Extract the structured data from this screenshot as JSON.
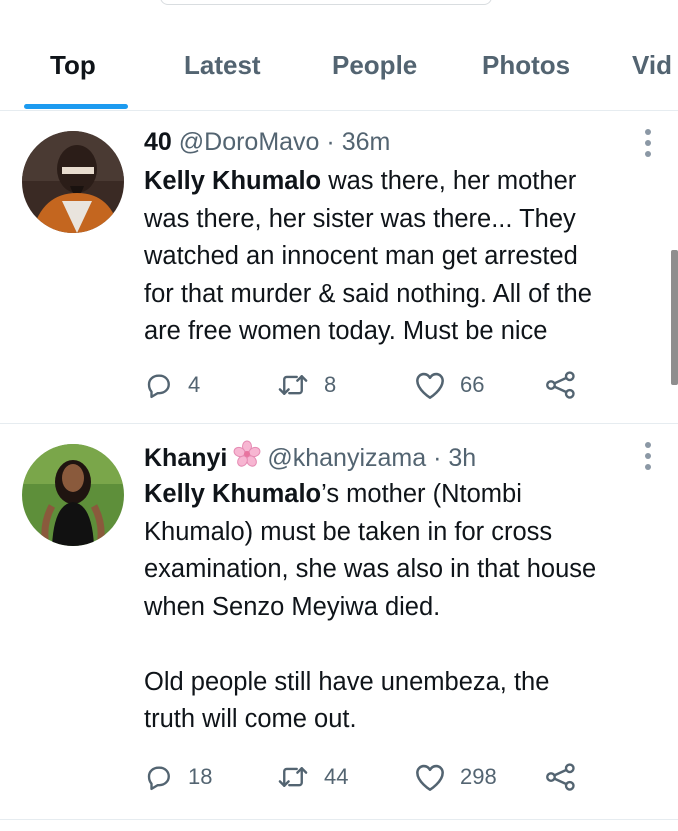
{
  "tabs": [
    {
      "label": "Top",
      "active": true
    },
    {
      "label": "Latest",
      "active": false
    },
    {
      "label": "People",
      "active": false
    },
    {
      "label": "Photos",
      "active": false
    },
    {
      "label": "Vid",
      "active": false
    }
  ],
  "accent_color": "#1d9bf0",
  "tweets": [
    {
      "name": "40",
      "handle": "@DoroMavo",
      "time": "· 36m",
      "mention": "Kelly Khumalo",
      "line1_rest": " was there, her mother",
      "lines": [
        "was there, her sister was there... They",
        "watched an innocent man get arrested",
        "for that murder & said nothing. All of the",
        "are free women today. Must be nice"
      ],
      "replies": "4",
      "retweets": "8",
      "likes": "66"
    },
    {
      "name": "Khanyi",
      "name_icon": "cherry-blossom-icon",
      "handle": "@khanyizama",
      "time": "· 3h",
      "mention": "Kelly Khumalo",
      "line1_rest": "’s mother (Ntombi",
      "lines": [
        "Khumalo) must be taken in for cross",
        "examination, she was also in that house",
        "when Senzo Meyiwa died."
      ],
      "para2": [
        "Old people still have unembeza, the",
        "truth will come out."
      ],
      "replies": "18",
      "retweets": "44",
      "likes": "298"
    }
  ]
}
